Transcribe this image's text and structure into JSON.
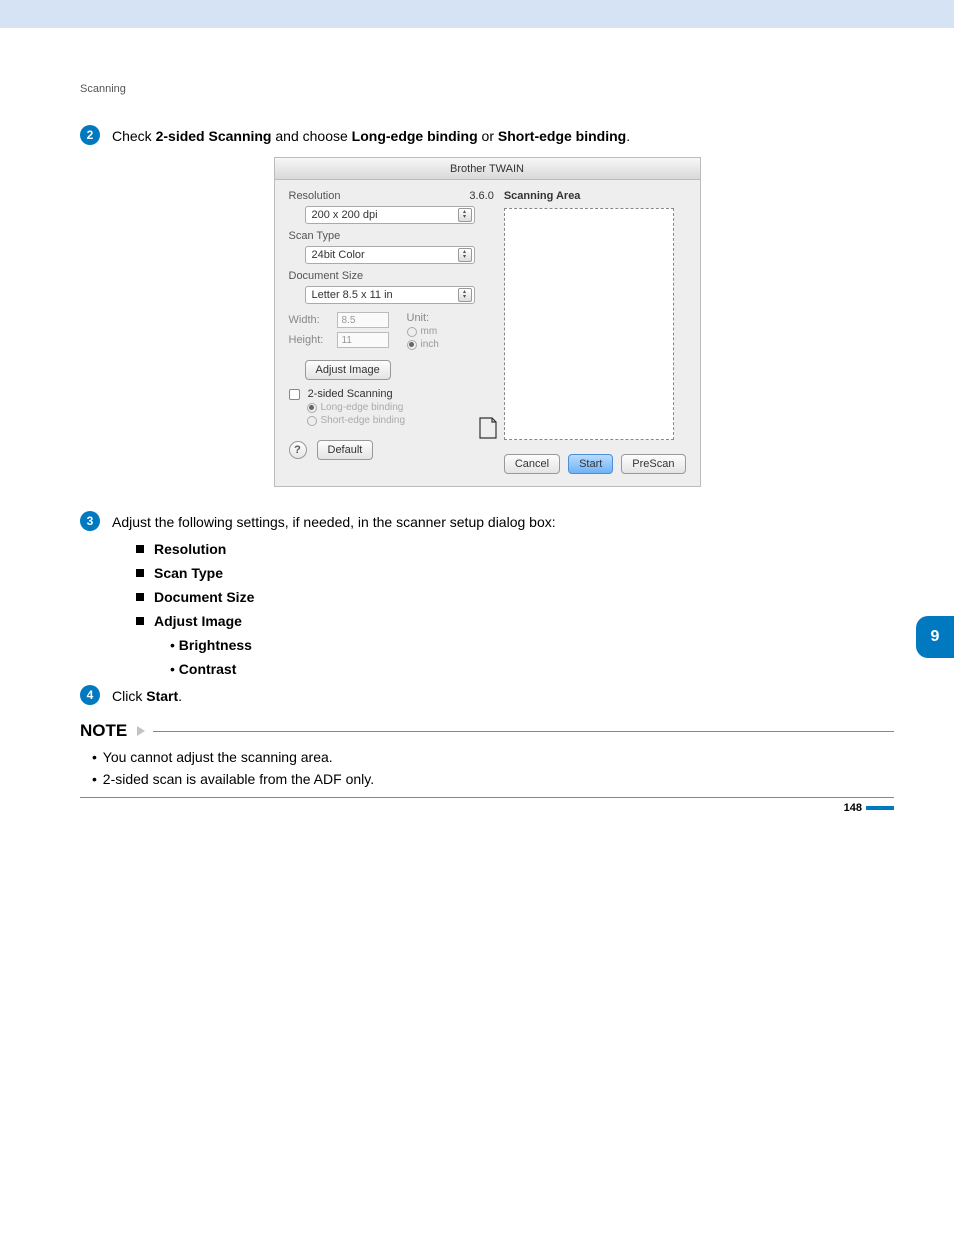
{
  "breadcrumb": "Scanning",
  "side_tab": "9",
  "page_number": "148",
  "step2": {
    "num": "2",
    "pre": "Check ",
    "b1": "2-sided Scanning",
    "mid1": " and choose ",
    "b2": "Long-edge binding",
    "mid2": " or ",
    "b3": "Short-edge binding",
    "post": "."
  },
  "dialog": {
    "title": "Brother TWAIN",
    "version": "3.6.0",
    "resolution_label": "Resolution",
    "resolution_value": "200 x 200 dpi",
    "scantype_label": "Scan Type",
    "scantype_value": "24bit Color",
    "docsize_label": "Document Size",
    "docsize_value": "Letter  8.5 x 11 in",
    "width_label": "Width:",
    "width_value": "8.5",
    "height_label": "Height:",
    "height_value": "11",
    "unit_label": "Unit:",
    "unit_mm": "mm",
    "unit_inch": "inch",
    "adjust_image": "Adjust Image",
    "twoside_label": "2-sided Scanning",
    "long_edge": "Long-edge binding",
    "short_edge": "Short-edge binding",
    "default_btn": "Default",
    "scanning_area": "Scanning Area",
    "cancel": "Cancel",
    "start": "Start",
    "prescan": "PreScan"
  },
  "step3": {
    "num": "3",
    "text": "Adjust the following settings, if needed, in the scanner setup dialog box:"
  },
  "settings": {
    "i0": "Resolution",
    "i1": "Scan Type",
    "i2": "Document Size",
    "i3": "Adjust Image",
    "s0": "Brightness",
    "s1": "Contrast"
  },
  "step4": {
    "num": "4",
    "pre": "Click ",
    "b1": "Start",
    "post": "."
  },
  "note": {
    "title": "NOTE",
    "li0": "You cannot adjust the scanning area.",
    "li1": "2-sided scan is available from the ADF only."
  }
}
